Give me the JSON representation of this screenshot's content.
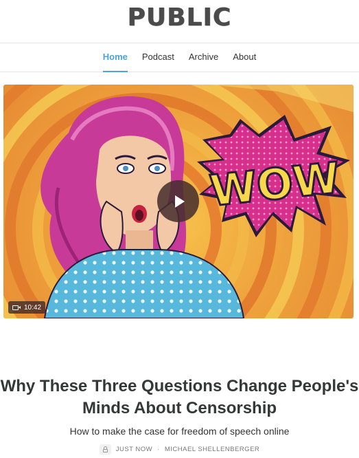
{
  "site": {
    "logo": "PUBLIC"
  },
  "nav": {
    "items": [
      "Home",
      "Podcast",
      "Archive",
      "About"
    ],
    "active": "Home"
  },
  "video": {
    "duration": "10:42",
    "illustration_text": "WOW"
  },
  "post": {
    "title": "Why These Three Questions Change People's Minds About Censorship",
    "subtitle": "How to make the case for freedom of speech online",
    "date": "JUST NOW",
    "separator": "·",
    "author": "MICHAEL SHELLENBERGER"
  },
  "colors": {
    "accent": "#4ba3d6",
    "title": "#363737",
    "meta": "#777777"
  }
}
